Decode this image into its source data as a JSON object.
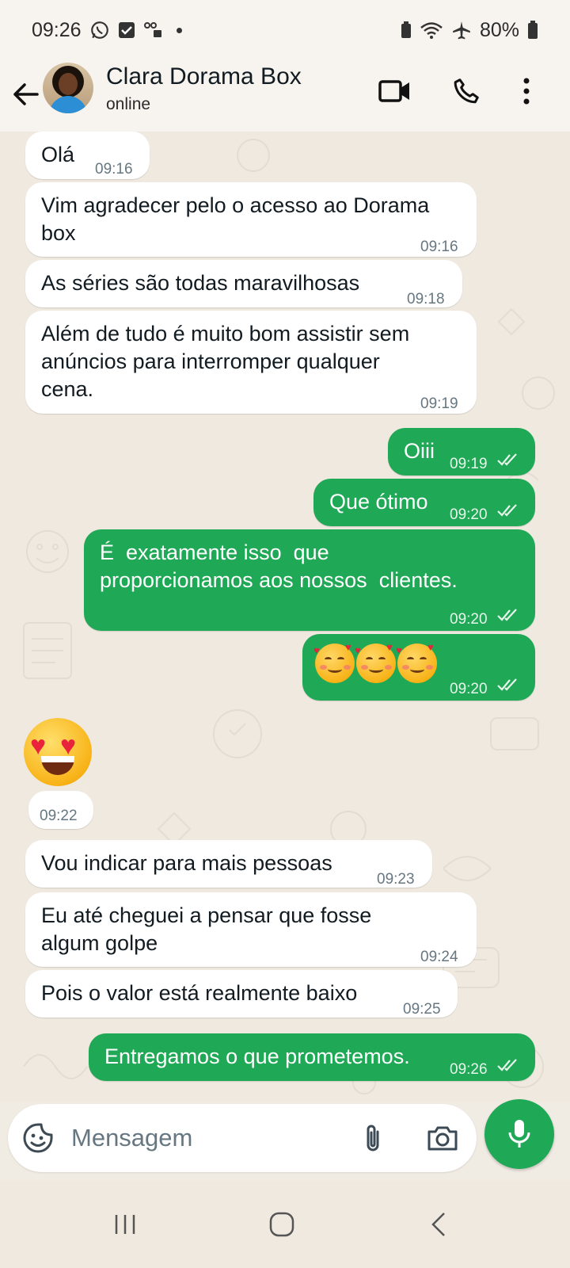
{
  "status_bar": {
    "time": "09:26",
    "battery": "80%"
  },
  "header": {
    "contact_name": "Clara Dorama Box",
    "contact_status": "online"
  },
  "messages": [
    {
      "direction": "in",
      "text": "Olá",
      "time": "09:16"
    },
    {
      "direction": "in",
      "text": "Vim agradecer pelo o acesso ao Dorama\nbox",
      "time": "09:16"
    },
    {
      "direction": "in",
      "text": "As séries são todas maravilhosas",
      "time": "09:18"
    },
    {
      "direction": "in",
      "text": "Além de tudo é muito bom assistir sem\nanúncios para interromper qualquer\ncena.",
      "time": "09:19"
    },
    {
      "direction": "out",
      "text": "Oiii",
      "time": "09:19",
      "read": true
    },
    {
      "direction": "out",
      "text": "Que ótimo",
      "time": "09:20",
      "read": true
    },
    {
      "direction": "out",
      "text": "É  exatamente isso  que\nproporcionamos aos nossos  clientes.",
      "time": "09:20",
      "read": true
    },
    {
      "direction": "out",
      "emoji": "smiling-face-with-hearts x3",
      "time": "09:20",
      "read": true
    },
    {
      "direction": "in",
      "emoji": "heart-eyes",
      "time": "09:22"
    },
    {
      "direction": "in",
      "text": "Vou indicar para mais pessoas",
      "time": "09:23"
    },
    {
      "direction": "in",
      "text": "Eu até cheguei a pensar que fosse\nalgum golpe",
      "time": "09:24"
    },
    {
      "direction": "in",
      "text": "Pois o valor está realmente baixo",
      "time": "09:25"
    },
    {
      "direction": "out",
      "text": "Entregamos o que prometemos.",
      "time": "09:26",
      "read": true
    }
  ],
  "input": {
    "placeholder": "Mensagem"
  },
  "colors": {
    "outgoing_bubble": "#1fa855",
    "incoming_bubble": "#ffffff",
    "chat_background": "#efe9df"
  }
}
